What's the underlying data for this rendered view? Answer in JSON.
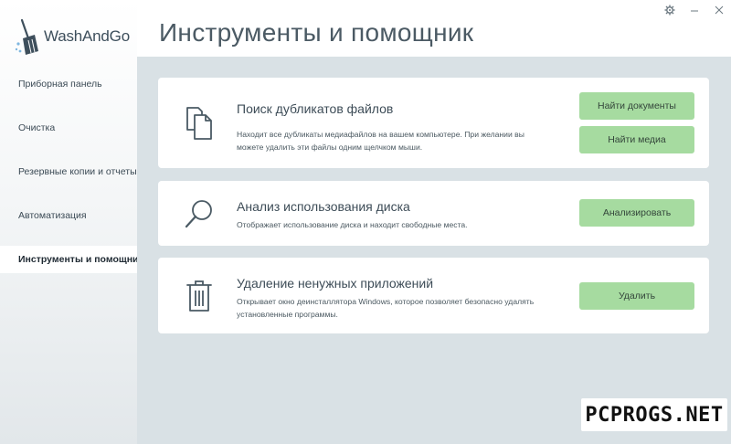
{
  "app": {
    "name": "WashAndGo",
    "logo_icon": "broom-icon"
  },
  "sidebar": {
    "items": [
      {
        "label": "Приборная панель"
      },
      {
        "label": "Очистка"
      },
      {
        "label": "Резервные копии и отчеты"
      },
      {
        "label": "Автоматизация"
      },
      {
        "label": "Инструменты и помощник",
        "active": true
      }
    ]
  },
  "header": {
    "title": "Инструменты и помощник",
    "settings_icon": "gear-icon",
    "minimize_icon": "minimize-icon",
    "close_icon": "close-icon"
  },
  "cards": [
    {
      "icon": "documents-icon",
      "title": "Поиск дубликатов файлов",
      "description": "Находит все дубликаты медиафайлов на вашем компьютере. При желании вы можете удалить эти файлы одним щелчком мыши.",
      "buttons": [
        "Найти документы",
        "Найти медиа"
      ]
    },
    {
      "icon": "magnifier-icon",
      "title": "Анализ использования диска",
      "description": "Отображает использование диска и находит свободные места.",
      "buttons": [
        "Анализировать"
      ]
    },
    {
      "icon": "trash-icon",
      "title": "Удаление ненужных приложений",
      "description": "Открывает окно деинсталлятора Windows, которое позволяет безопасно удалять установленные программы.",
      "buttons": [
        "Удалить"
      ]
    }
  ],
  "watermark": "PCPROGS.NET",
  "colors": {
    "button_green": "#a6dba0",
    "content_bg": "#d9e1e5",
    "sidebar_bg": "#f4f6f7"
  }
}
